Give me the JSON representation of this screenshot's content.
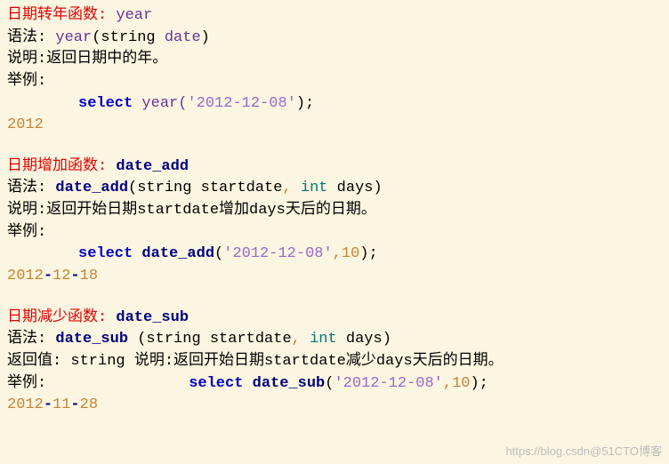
{
  "sec1": {
    "title_zh": "日期转年函数: ",
    "title_fn": "year",
    "syntax_lbl": "语法: ",
    "sig_fn": "year",
    "sig_p": "(string ",
    "sig_arg": "date",
    "sig_close": ")",
    "desc": "说明:返回日期中的年。",
    "ex_lbl": "举例:",
    "kw": "select ",
    "call_fn": "year(",
    "call_arg": "'2012-12-08'",
    "call_end": ");",
    "result": "2012"
  },
  "sec2": {
    "title_zh": "日期增加函数: ",
    "title_fn": "date_add",
    "syntax_lbl": "语法: ",
    "sig_fn": "date_add",
    "sig_open": "(string startdate",
    "sig_c1": ",",
    "sig_type": " int",
    "sig_days": " days",
    "sig_close": ")",
    "desc": "说明:返回开始日期startdate增加days天后的日期。",
    "ex_lbl": "举例:",
    "kw": "select ",
    "call_fn": "date_add",
    "call_p": "(",
    "call_arg": "'2012-12-08'",
    "call_c": ",",
    "call_n": "10",
    "call_end": ");",
    "r_y": "2012",
    "r_d1": "-",
    "r_m": "12",
    "r_d2": "-",
    "r_dd": "18"
  },
  "sec3": {
    "title_zh": "日期减少函数: ",
    "title_fn": "date_sub",
    "syntax_lbl": "语法: ",
    "sig_fn": "date_sub ",
    "sig_open": "(string startdate",
    "sig_c1": ",",
    "sig_type": " int",
    "sig_days": " days",
    "sig_close": ")",
    "ret_lbl": "返回值:",
    "ret_type": " string ",
    "desc": "说明:返回开始日期startdate减少days天后的日期。",
    "ex_lbl": "举例:",
    "kw": "select ",
    "call_fn": "date_sub",
    "call_p": "(",
    "call_arg": "'2012-12-08'",
    "call_c": ",",
    "call_n": "10",
    "call_end": ");",
    "r_y": "2012",
    "r_d1": "-",
    "r_m": "11",
    "r_d2": "-",
    "r_dd": "28"
  },
  "watermark": "https://blog.csdn@51CTO博客"
}
